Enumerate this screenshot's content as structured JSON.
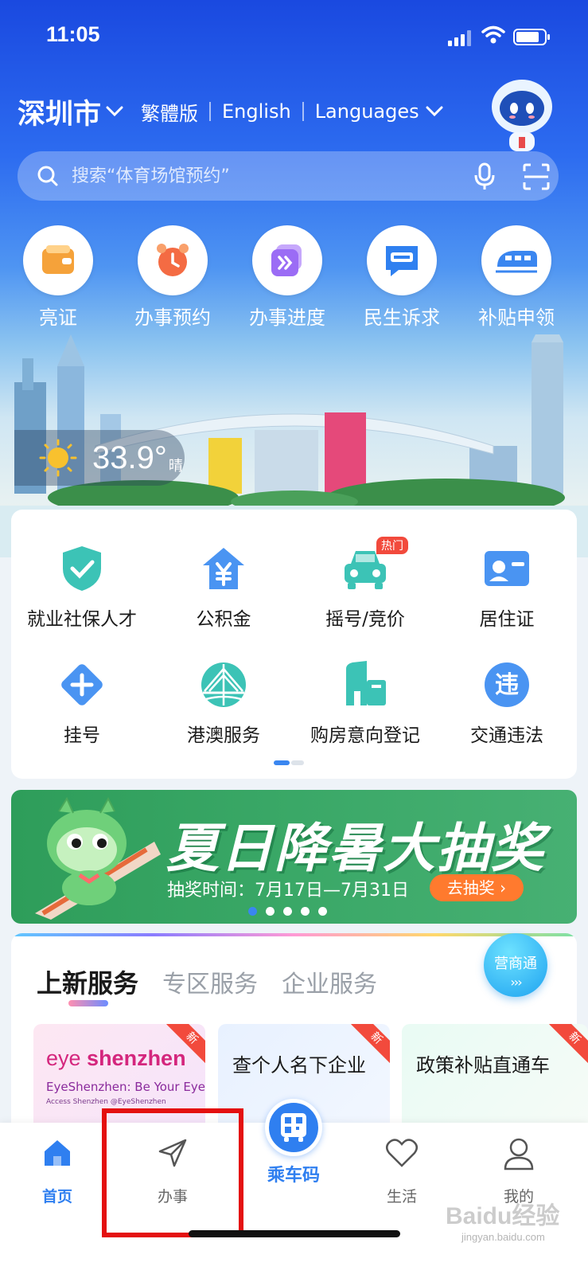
{
  "status_bar": {
    "time": "11:05"
  },
  "header": {
    "city": "深圳市",
    "languages": [
      "繁體版",
      "English",
      "Languages"
    ]
  },
  "search": {
    "placeholder": "搜索“体育场馆预约”"
  },
  "quick_actions": [
    {
      "label": "亮证",
      "icon": "wallet-icon",
      "color": "#f5a23a"
    },
    {
      "label": "办事预约",
      "icon": "alarm-clock-icon",
      "color": "#f46b43"
    },
    {
      "label": "办事进度",
      "icon": "forward-arrows-icon",
      "color": "#9b6cf5"
    },
    {
      "label": "民生诉求",
      "icon": "message-shenzhen-icon",
      "color": "#2f80f0"
    },
    {
      "label": "补贴申领",
      "icon": "train-icon",
      "color": "#3a86f0"
    }
  ],
  "weather": {
    "temperature": "33.9°",
    "condition": "晴"
  },
  "services": {
    "items": [
      {
        "label": "就业社保人才",
        "icon": "shield-check-icon"
      },
      {
        "label": "公积金",
        "icon": "house-yuan-icon"
      },
      {
        "label": "摇号/竞价",
        "icon": "car-icon",
        "badge": "热门"
      },
      {
        "label": "居住证",
        "icon": "id-card-icon"
      },
      {
        "label": "挂号",
        "icon": "medical-cross-icon"
      },
      {
        "label": "港澳服务",
        "icon": "bridge-icon"
      },
      {
        "label": "购房意向登记",
        "icon": "building-icon"
      },
      {
        "label": "交通违法",
        "icon": "violation-icon"
      }
    ]
  },
  "banner": {
    "title": "夏日降暑大抽奖",
    "subtitle": "抽奖时间：7月17日—7月31日",
    "button": "去抽奖 ›"
  },
  "new_services": {
    "tabs": [
      "上新服务",
      "专区服务",
      "企业服务"
    ],
    "float_button": {
      "label": "营商通",
      "arrows": "›››"
    },
    "cards": [
      {
        "tag": "新",
        "title_a": "eye ",
        "title_b": "shenzhen",
        "subtitle": "EyeShenzhen: Be Your Eyes",
        "small": "Access Shenzhen  @EyeShenzhen"
      },
      {
        "tag": "新",
        "title": "查个人名下企业"
      },
      {
        "tag": "新",
        "title": "政策补贴直通车"
      }
    ]
  },
  "tab_bar": {
    "items": [
      "首页",
      "办事",
      "乘车码",
      "生活",
      "我的"
    ],
    "active": "首页",
    "accent": "#2f7ff0"
  },
  "watermark": {
    "brand": "Baidu经验",
    "url": "jingyan.baidu.com"
  }
}
